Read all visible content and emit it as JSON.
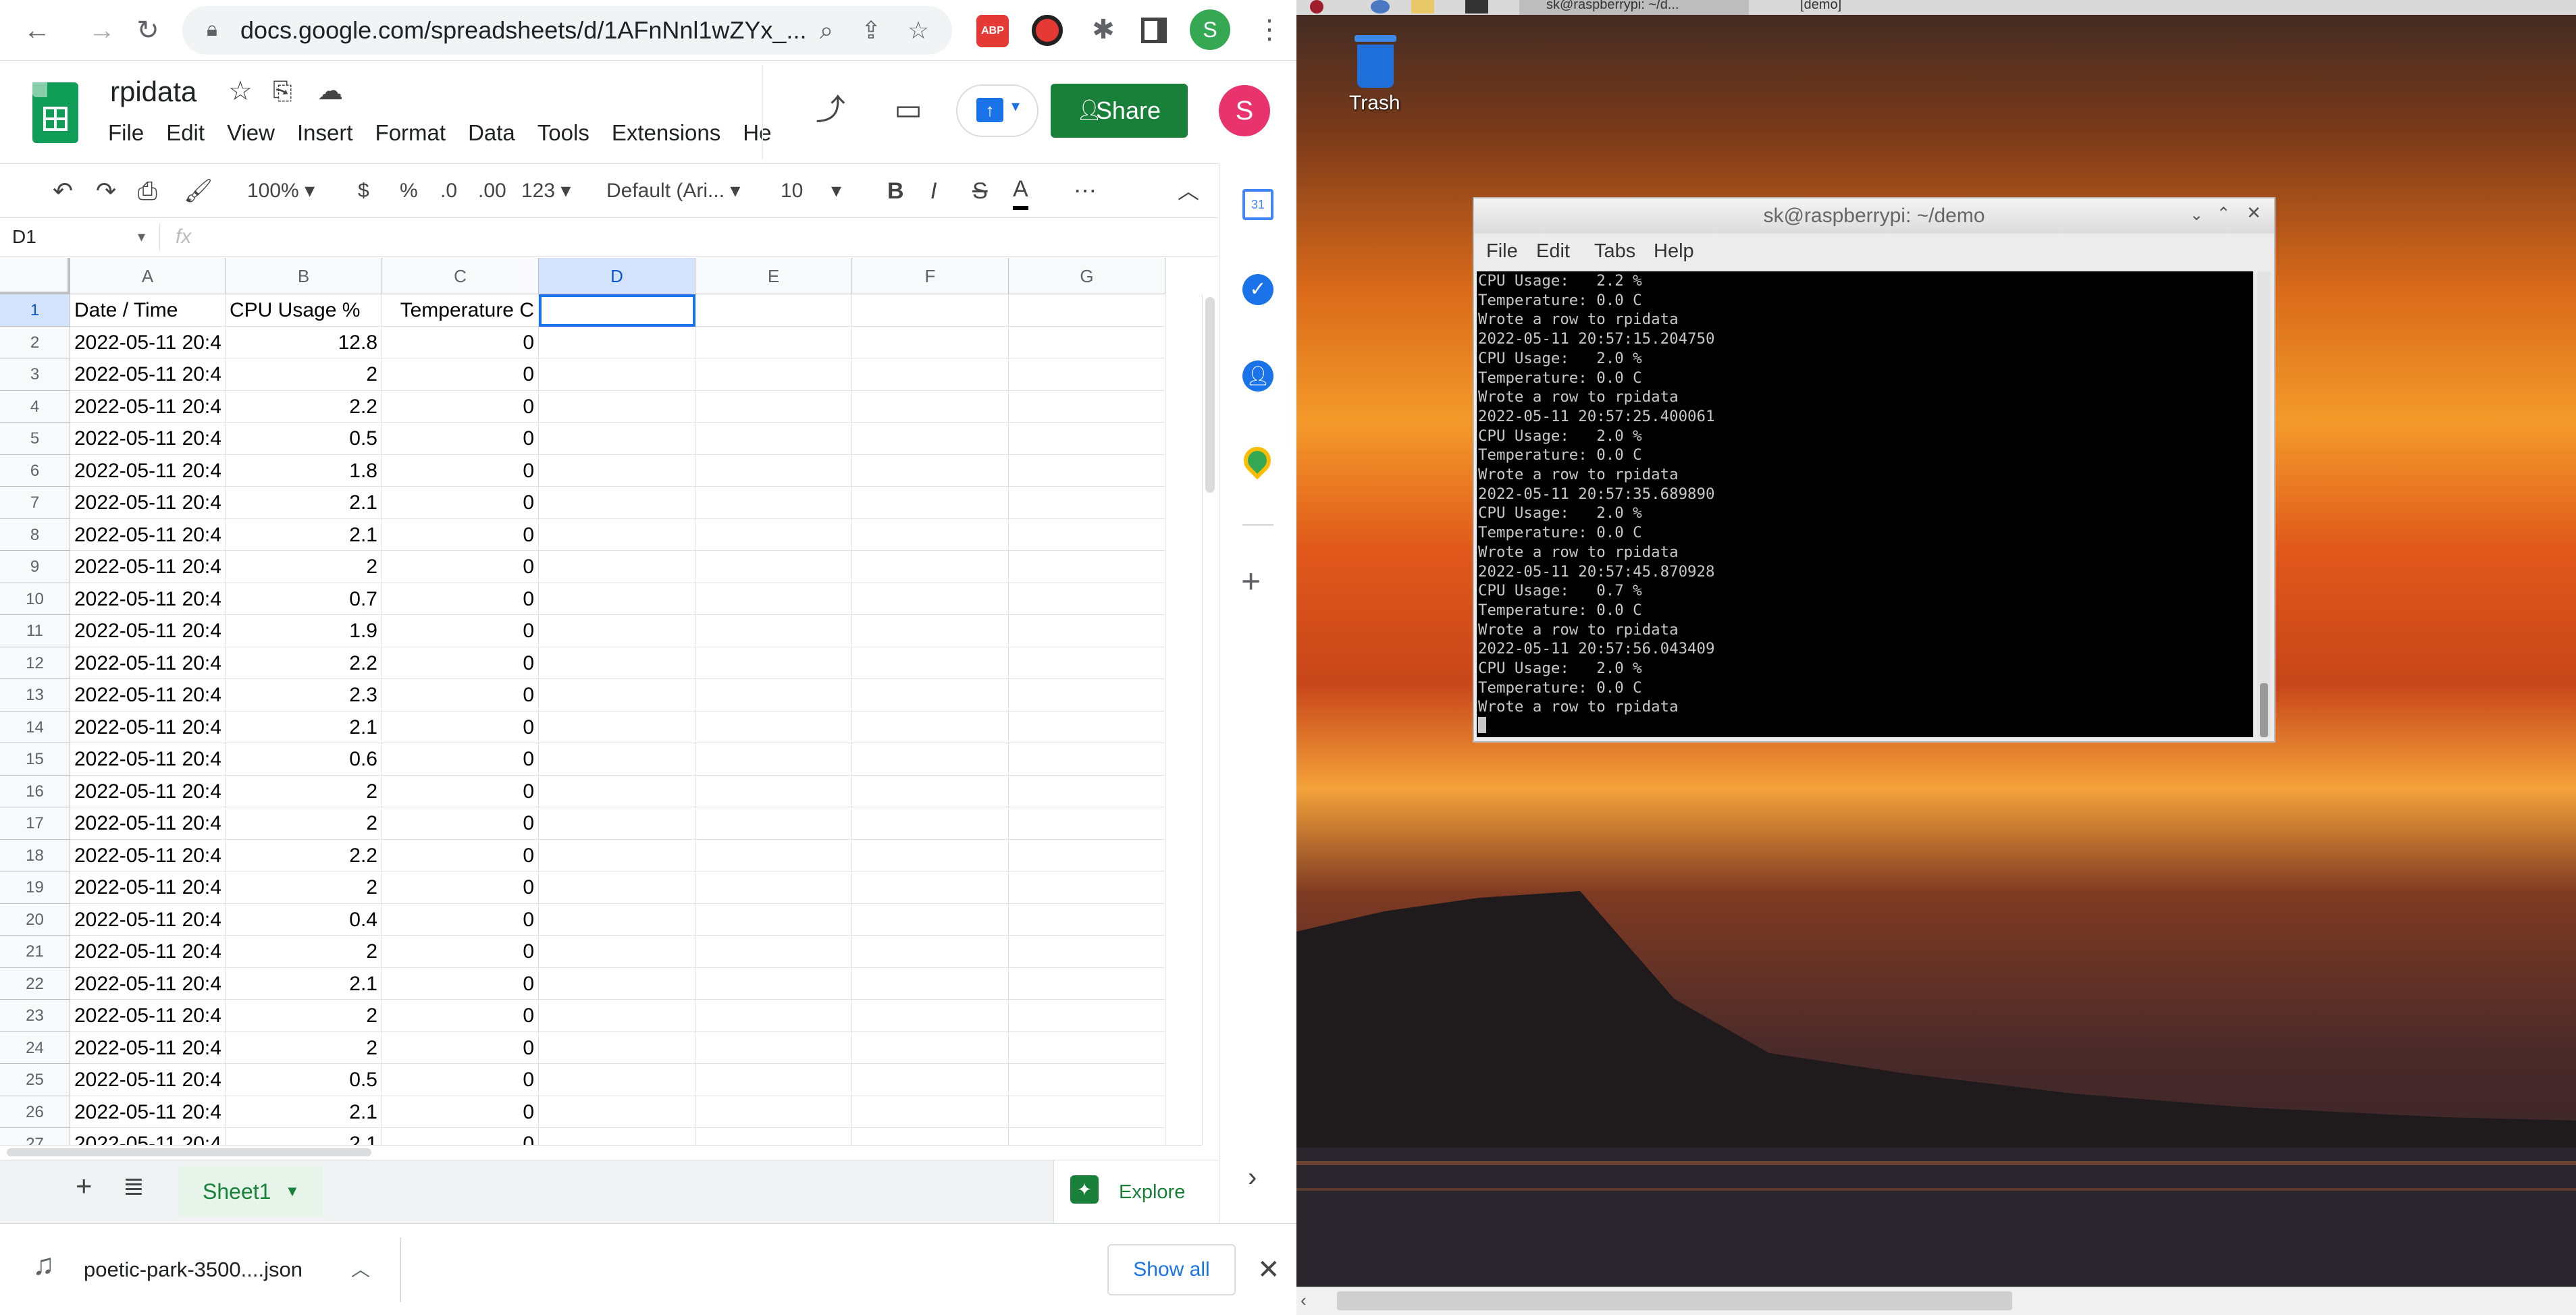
{
  "browser": {
    "url": "docs.google.com/spreadsheets/d/1AFnNnl1wZYx_...",
    "profile_initial": "S",
    "ext_abp": "ABP"
  },
  "doc": {
    "title": "rpidata",
    "menu": [
      "File",
      "Edit",
      "View",
      "Insert",
      "Format",
      "Data",
      "Tools",
      "Extensions",
      "He"
    ],
    "share_label": "Share",
    "avatar": "S"
  },
  "toolbar": {
    "zoom": "100%",
    "currency": "$",
    "percent": "%",
    "dec_less": ".0",
    "dec_more": ".00",
    "more_formats": "123",
    "font": "Default (Ari...",
    "size": "10",
    "bold": "B",
    "italic": "I",
    "strike": "S",
    "text_color": "A",
    "more": "⋯"
  },
  "formula": {
    "cell_ref": "D1",
    "fx": "fx",
    "value": ""
  },
  "grid": {
    "columns": [
      "A",
      "B",
      "C",
      "D",
      "E",
      "F",
      "G"
    ],
    "header": [
      "Date / Time",
      "CPU Usage %",
      "Temperature C"
    ],
    "rows": [
      [
        "2022-05-11 20:4",
        "12.8",
        "0"
      ],
      [
        "2022-05-11 20:4",
        "2",
        "0"
      ],
      [
        "2022-05-11 20:4",
        "2.2",
        "0"
      ],
      [
        "2022-05-11 20:4",
        "0.5",
        "0"
      ],
      [
        "2022-05-11 20:4",
        "1.8",
        "0"
      ],
      [
        "2022-05-11 20:4",
        "2.1",
        "0"
      ],
      [
        "2022-05-11 20:4",
        "2.1",
        "0"
      ],
      [
        "2022-05-11 20:4",
        "2",
        "0"
      ],
      [
        "2022-05-11 20:4",
        "0.7",
        "0"
      ],
      [
        "2022-05-11 20:4",
        "1.9",
        "0"
      ],
      [
        "2022-05-11 20:4",
        "2.2",
        "0"
      ],
      [
        "2022-05-11 20:4",
        "2.3",
        "0"
      ],
      [
        "2022-05-11 20:4",
        "2.1",
        "0"
      ],
      [
        "2022-05-11 20:4",
        "0.6",
        "0"
      ],
      [
        "2022-05-11 20:4",
        "2",
        "0"
      ],
      [
        "2022-05-11 20:4",
        "2",
        "0"
      ],
      [
        "2022-05-11 20:4",
        "2.2",
        "0"
      ],
      [
        "2022-05-11 20:4",
        "2",
        "0"
      ],
      [
        "2022-05-11 20:4",
        "0.4",
        "0"
      ],
      [
        "2022-05-11 20:4",
        "2",
        "0"
      ],
      [
        "2022-05-11 20:4",
        "2.1",
        "0"
      ],
      [
        "2022-05-11 20:4",
        "2",
        "0"
      ],
      [
        "2022-05-11 20:4",
        "2",
        "0"
      ],
      [
        "2022-05-11 20:4",
        "0.5",
        "0"
      ],
      [
        "2022-05-11 20:4",
        "2.1",
        "0"
      ],
      [
        "2022-05-11 20:4",
        "2.1",
        "0"
      ]
    ],
    "row_numbers": [
      "1",
      "2",
      "3",
      "4",
      "5",
      "6",
      "7",
      "8",
      "9",
      "10",
      "11",
      "12",
      "13",
      "14",
      "15",
      "16",
      "17",
      "18",
      "19",
      "20",
      "21",
      "22",
      "23",
      "24",
      "25",
      "26",
      "27"
    ]
  },
  "sheets": {
    "tab": "Sheet1",
    "explore": "Explore"
  },
  "download": {
    "file": "poetic-park-3500....json",
    "show_all": "Show all"
  },
  "desktop": {
    "trash_label": "Trash",
    "taskbar_items": [
      "sk@raspberrypi: ~/d...",
      "[demo]"
    ]
  },
  "terminal": {
    "title": "sk@raspberrypi: ~/demo",
    "menu": [
      "File",
      "Edit",
      "Tabs",
      "Help"
    ],
    "lines": [
      "CPU Usage:   2.2 %",
      "Temperature: 0.0 C",
      "Wrote a row to rpidata",
      "2022-05-11 20:57:15.204750",
      "CPU Usage:   2.0 %",
      "Temperature: 0.0 C",
      "Wrote a row to rpidata",
      "2022-05-11 20:57:25.400061",
      "CPU Usage:   2.0 %",
      "Temperature: 0.0 C",
      "Wrote a row to rpidata",
      "2022-05-11 20:57:35.689890",
      "CPU Usage:   2.0 %",
      "Temperature: 0.0 C",
      "Wrote a row to rpidata",
      "2022-05-11 20:57:45.870928",
      "CPU Usage:   0.7 %",
      "Temperature: 0.0 C",
      "Wrote a row to rpidata",
      "2022-05-11 20:57:56.043409",
      "CPU Usage:   2.0 %",
      "Temperature: 0.0 C",
      "Wrote a row to rpidata"
    ]
  }
}
